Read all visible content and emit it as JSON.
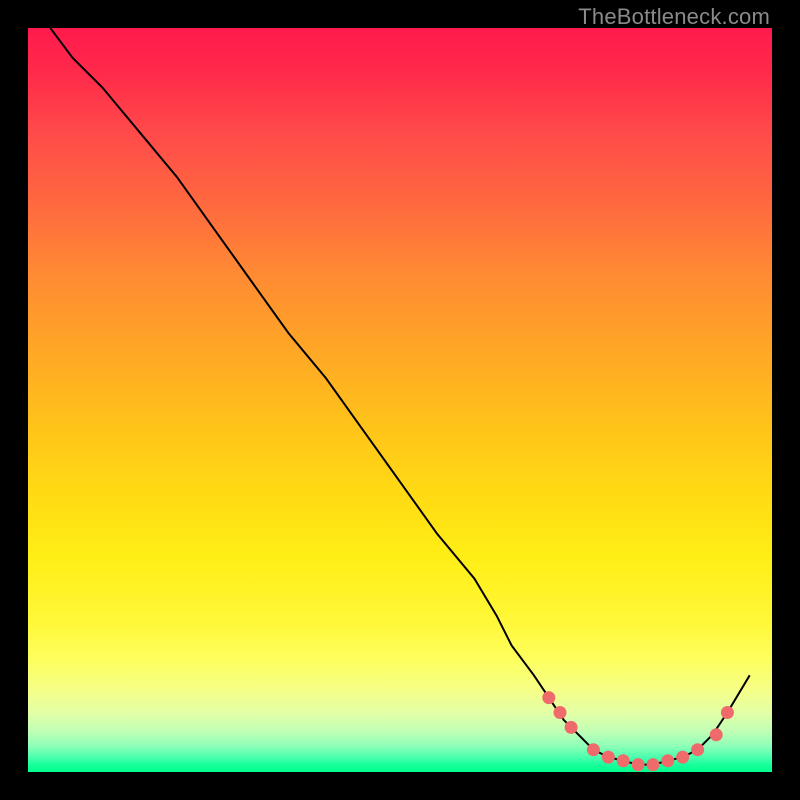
{
  "watermark": "TheBottleneck.com",
  "chart_data": {
    "type": "line",
    "title": "",
    "xlabel": "",
    "ylabel": "",
    "xlim": [
      0,
      100
    ],
    "ylim": [
      0,
      100
    ],
    "grid": false,
    "legend": false,
    "series": [
      {
        "name": "bottleneck-curve",
        "x": [
          3,
          6,
          10,
          15,
          20,
          25,
          30,
          35,
          40,
          45,
          50,
          55,
          60,
          63,
          65,
          68,
          70,
          72,
          74,
          76,
          78,
          80,
          82,
          84,
          86,
          88,
          90,
          92,
          94,
          97
        ],
        "values": [
          100,
          96,
          92,
          86,
          80,
          73,
          66,
          59,
          53,
          46,
          39,
          32,
          26,
          21,
          17,
          13,
          10,
          7,
          5,
          3,
          2,
          1.5,
          1,
          1,
          1.5,
          2,
          3,
          5,
          8,
          13
        ]
      }
    ],
    "scatter": {
      "name": "highlight-dots",
      "x": [
        70,
        71.5,
        73,
        76,
        78,
        80,
        82,
        84,
        86,
        88,
        90,
        92.5,
        94
      ],
      "values": [
        10,
        8,
        6,
        3,
        2,
        1.5,
        1,
        1,
        1.5,
        2,
        3,
        5,
        8
      ]
    },
    "colors": {
      "curve": "#000000",
      "dots": "#ef6b6b",
      "gradient_top": "#ff1a4d",
      "gradient_mid": "#ffee15",
      "gradient_bottom": "#00ff8e",
      "frame": "#000000"
    }
  }
}
